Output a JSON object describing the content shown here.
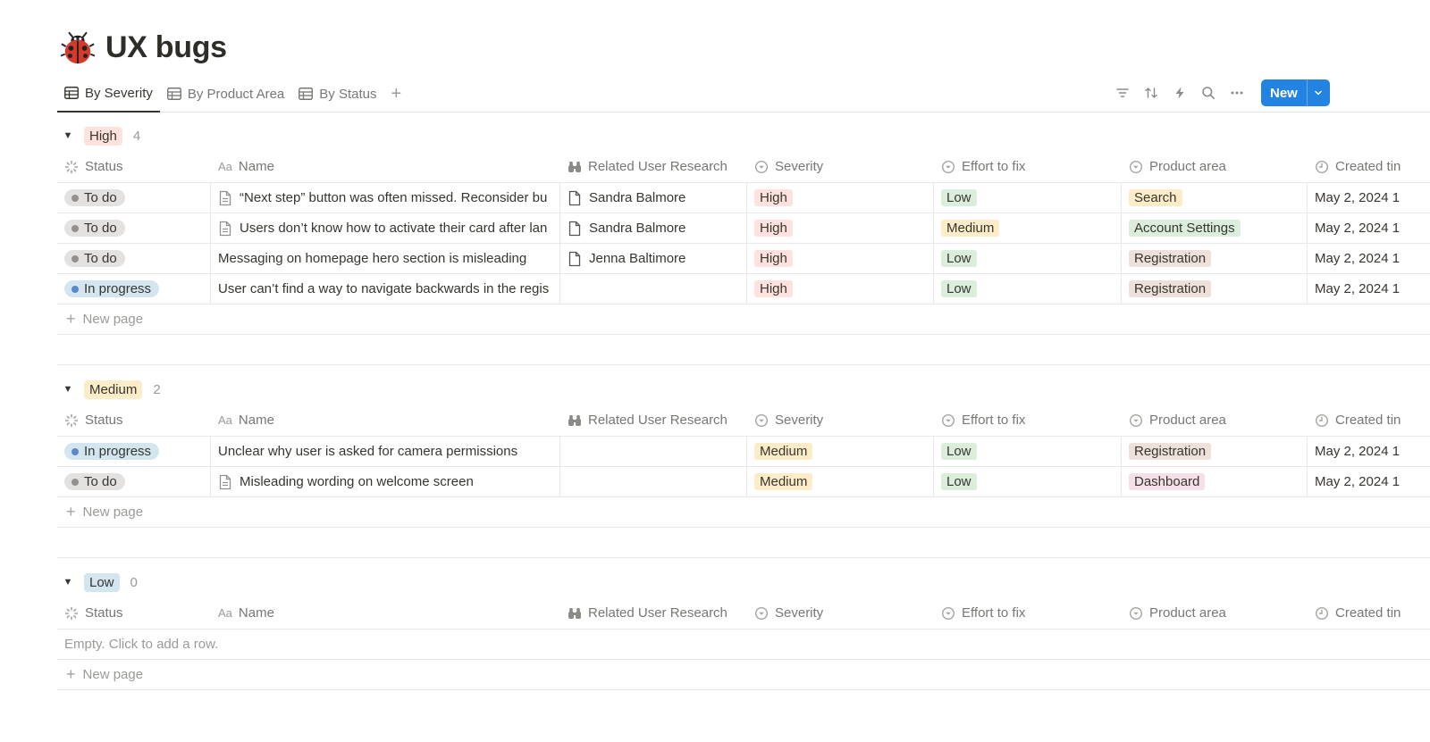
{
  "page": {
    "title": "UX bugs",
    "icon": "ladybug-icon"
  },
  "views": {
    "tabs": [
      {
        "label": "By Severity",
        "active": true
      },
      {
        "label": "By Product Area",
        "active": false
      },
      {
        "label": "By Status",
        "active": false
      }
    ],
    "new_label": "New"
  },
  "columns": {
    "status": "Status",
    "name": "Name",
    "research": "Related User Research",
    "severity": "Severity",
    "effort": "Effort to fix",
    "area": "Product area",
    "created": "Created tin"
  },
  "colors": {
    "accent": "#2383e2",
    "red_tag": "#ffe2dd",
    "yellow_tag": "#fdecc8",
    "blue_tag": "#d3e5ef",
    "green_tag": "#dbeddb",
    "brown_tag": "#eee0da",
    "pink_tag": "#f5e0e9",
    "gray_pill": "#e3e2e0",
    "blue_pill": "#d3e5ef"
  },
  "groups": [
    {
      "label": "High",
      "count": "4",
      "rows": [
        {
          "status": "To do",
          "name": "“Next step” button was often missed. Reconsider bu",
          "has_doc": true,
          "research": "Sandra Balmore",
          "severity": "High",
          "effort": "Low",
          "area": "Search",
          "created": "May 2, 2024 1"
        },
        {
          "status": "To do",
          "name": "Users don’t know how to activate their card after lan",
          "has_doc": true,
          "research": "Sandra Balmore",
          "severity": "High",
          "effort": "Medium",
          "area": "Account Settings",
          "created": "May 2, 2024 1"
        },
        {
          "status": "To do",
          "name": "Messaging on homepage hero section is misleading",
          "has_doc": false,
          "research": "Jenna Baltimore",
          "severity": "High",
          "effort": "Low",
          "area": "Registration",
          "created": "May 2, 2024 1"
        },
        {
          "status": "In progress",
          "name": "User can’t find a way to navigate backwards in the regis",
          "has_doc": false,
          "research": "",
          "severity": "High",
          "effort": "Low",
          "area": "Registration",
          "created": "May 2, 2024 1"
        }
      ]
    },
    {
      "label": "Medium",
      "count": "2",
      "rows": [
        {
          "status": "In progress",
          "name": "Unclear why user is asked for camera permissions",
          "has_doc": false,
          "research": "",
          "severity": "Medium",
          "effort": "Low",
          "area": "Registration",
          "created": "May 2, 2024 1"
        },
        {
          "status": "To do",
          "name": "Misleading wording on welcome screen",
          "has_doc": true,
          "research": "",
          "severity": "Medium",
          "effort": "Low",
          "area": "Dashboard",
          "created": "May 2, 2024 1"
        }
      ]
    },
    {
      "label": "Low",
      "count": "0",
      "rows": [],
      "empty_text": "Empty. Click to add a row."
    }
  ],
  "new_page_label": "New page"
}
